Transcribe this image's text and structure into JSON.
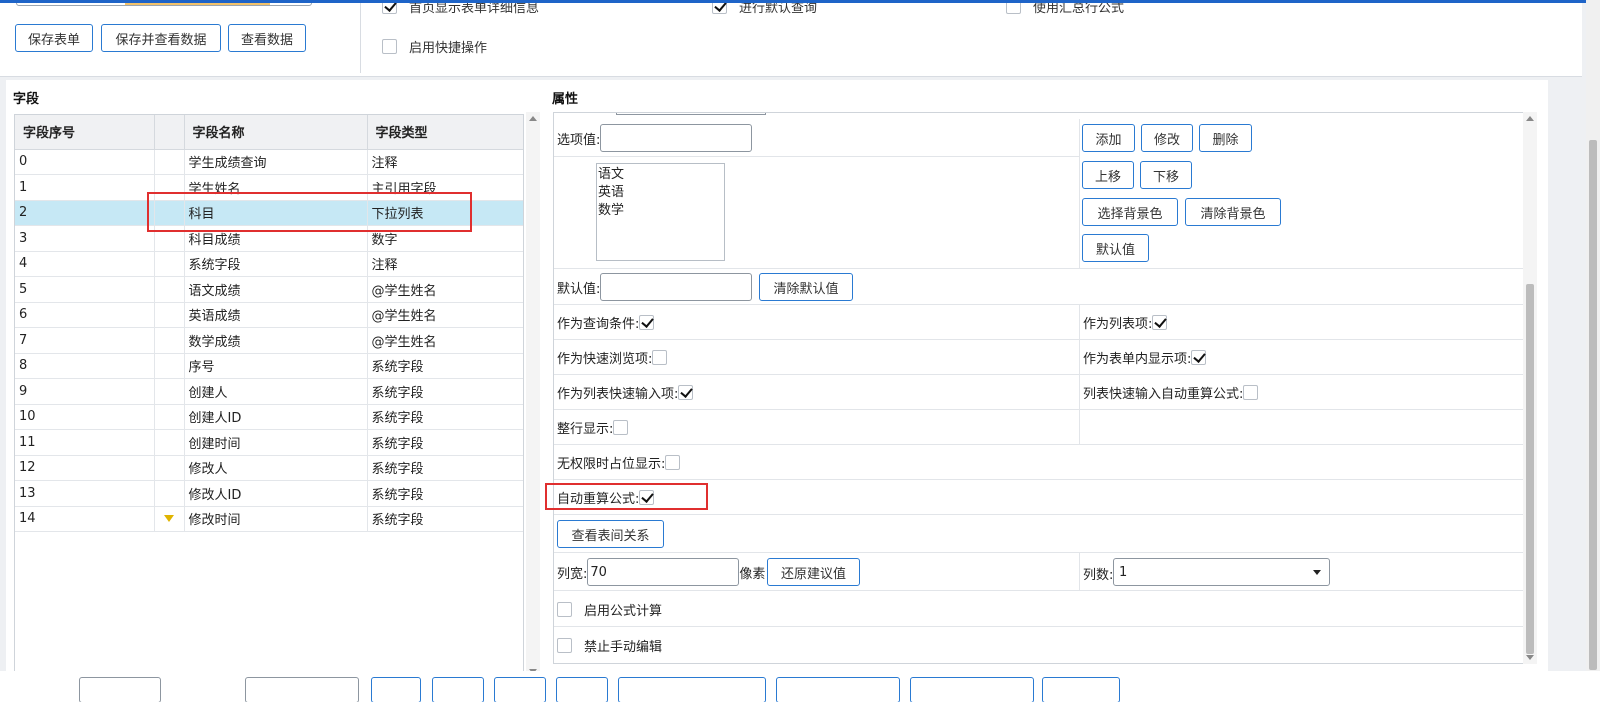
{
  "toolbar": {
    "save_form": "保存表单",
    "save_and_view": "保存并查看数据",
    "view_data": "查看数据",
    "options": [
      {
        "label": "首页显示表单详细信息",
        "checked": true
      },
      {
        "label": "进行默认查询",
        "checked": true
      },
      {
        "label": "使用汇总行公式",
        "checked": false
      },
      {
        "label": "启用快捷操作",
        "checked": false
      }
    ]
  },
  "fields": {
    "title": "字段",
    "columns": [
      "字段序号",
      "",
      "字段名称",
      "字段类型"
    ],
    "rows": [
      {
        "no": "0",
        "name": "学生成绩查询",
        "type": "注释"
      },
      {
        "no": "1",
        "name": "学生姓名",
        "type": "主引用字段"
      },
      {
        "no": "2",
        "name": "科目",
        "type": "下拉列表"
      },
      {
        "no": "3",
        "name": "科目成绩",
        "type": "数字"
      },
      {
        "no": "4",
        "name": "系统字段",
        "type": "注释"
      },
      {
        "no": "5",
        "name": "语文成绩",
        "type": "@学生姓名"
      },
      {
        "no": "6",
        "name": "英语成绩",
        "type": "@学生姓名"
      },
      {
        "no": "7",
        "name": "数学成绩",
        "type": "@学生姓名"
      },
      {
        "no": "8",
        "name": "序号",
        "type": "系统字段"
      },
      {
        "no": "9",
        "name": "创建人",
        "type": "系统字段"
      },
      {
        "no": "10",
        "name": "创建人ID",
        "type": "系统字段"
      },
      {
        "no": "11",
        "name": "创建时间",
        "type": "系统字段"
      },
      {
        "no": "12",
        "name": "修改人",
        "type": "系统字段"
      },
      {
        "no": "13",
        "name": "修改人ID",
        "type": "系统字段"
      },
      {
        "no": "14",
        "name": "修改时间",
        "type": "系统字段"
      }
    ],
    "selected_index": 2
  },
  "props": {
    "title": "属性",
    "option_value_label": "选项值:",
    "option_value": "",
    "add": "添加",
    "modify": "修改",
    "delete": "删除",
    "move_up": "上移",
    "move_down": "下移",
    "choose_bg": "选择背景色",
    "clear_bg": "清除背景色",
    "default_btn": "默认值",
    "options_list": [
      "语文",
      "英语",
      "数学"
    ],
    "default_value_label": "默认值:",
    "default_value": "",
    "clear_default": "清除默认值",
    "as_query": {
      "label": "作为查询条件:",
      "checked": true
    },
    "as_list_item": {
      "label": "作为列表项:",
      "checked": true
    },
    "as_quick_browse": {
      "label": "作为快速浏览项:",
      "checked": false
    },
    "as_form_display": {
      "label": "作为表单内显示项:",
      "checked": true
    },
    "as_list_quick_input": {
      "label": "作为列表快速输入项:",
      "checked": true
    },
    "list_quick_auto_recalc": {
      "label": "列表快速输入自动重算公式:",
      "checked": false
    },
    "whole_row": {
      "label": "整行显示:",
      "checked": false
    },
    "no_perm_placeholder": {
      "label": "无权限时占位显示:",
      "checked": false
    },
    "auto_recalc": {
      "label": "自动重算公式:",
      "checked": true
    },
    "view_relations": "查看表间关系",
    "col_width_label": "列宽:",
    "col_width": "70",
    "pixel_unit": "像素",
    "restore_suggested": "还原建议值",
    "col_count_label": "列数:",
    "col_count": "1",
    "enable_formula": {
      "label": "启用公式计算",
      "checked": false
    },
    "disable_manual_edit": {
      "label": "禁止手动编辑",
      "checked": false
    }
  }
}
